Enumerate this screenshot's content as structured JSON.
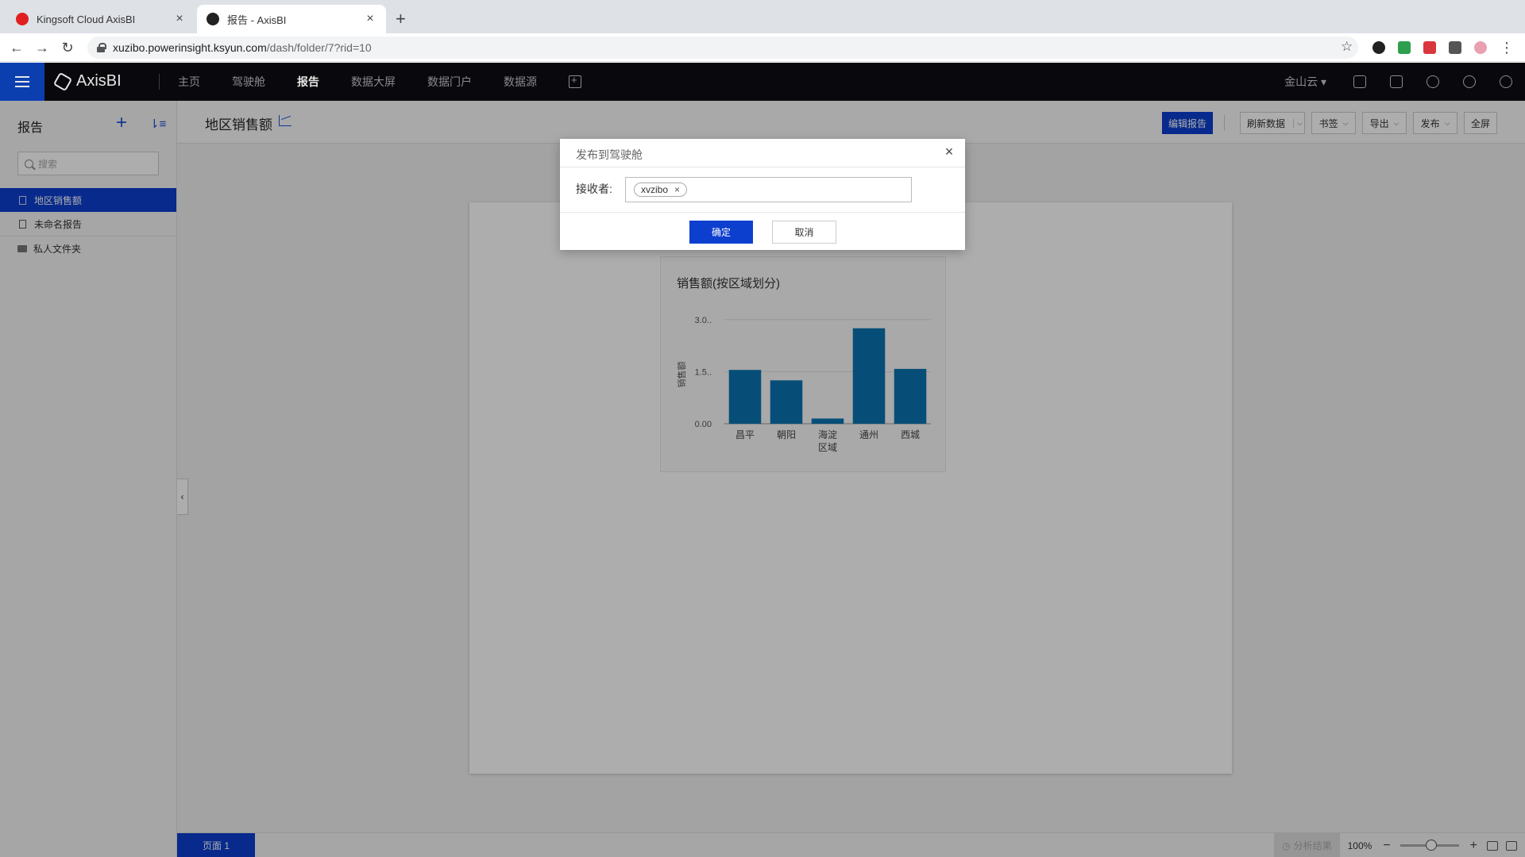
{
  "browser": {
    "tabs": [
      {
        "label": "Kingsoft Cloud AxisBI",
        "favicon_color": "#e02020"
      },
      {
        "label": "报告 - AxisBI",
        "favicon_color": "#222222"
      }
    ],
    "url_host": "xuzibo.powerinsight.ksyun.com",
    "url_path": "/dash/folder/7?rid=10"
  },
  "app": {
    "logo": "AxisBI",
    "nav": [
      "主页",
      "驾驶舱",
      "报告",
      "数据大屏",
      "数据门户",
      "数据源"
    ],
    "active_nav": "报告",
    "org": "金山云"
  },
  "sidebar": {
    "title": "报告",
    "search_placeholder": "搜索",
    "items": [
      {
        "label": "地区销售额",
        "type": "report",
        "selected": true
      },
      {
        "label": "未命名报告",
        "type": "report",
        "selected": false
      },
      {
        "label": "私人文件夹",
        "type": "folder",
        "selected": false
      }
    ]
  },
  "toolbar": {
    "report_title": "地区销售额",
    "edit_label": "编辑报告",
    "refresh_label": "刷新数据",
    "bookmark_label": "书签",
    "export_label": "导出",
    "publish_label": "发布",
    "fullscreen_label": "全屏"
  },
  "chart_data": {
    "type": "bar",
    "title": "销售额(按区域划分)",
    "ylabel": "销售额",
    "xlabel": "",
    "categories": [
      "昌平",
      "朝阳",
      "海淀区域",
      "通州",
      "西城"
    ],
    "category_lines": [
      [
        "昌平"
      ],
      [
        "朝阳"
      ],
      [
        "海淀",
        "区域"
      ],
      [
        "通州"
      ],
      [
        "西城"
      ]
    ],
    "values": [
      1.55,
      1.25,
      0.15,
      2.75,
      1.58
    ],
    "ylim": [
      0,
      3.2
    ],
    "yticks": [
      {
        "value": 0,
        "label": "0.00"
      },
      {
        "value": 1.5,
        "label": "1.5.."
      },
      {
        "value": 3.0,
        "label": "3.0.."
      }
    ],
    "bar_color": "#0a73b0",
    "grid": true
  },
  "footer": {
    "page_tab": "页面 1",
    "analysis_label": "分析结果",
    "zoom": "100%"
  },
  "modal": {
    "title": "发布到驾驶舱",
    "receiver_label": "接收者:",
    "tag": "xvzibo",
    "ok_label": "确定",
    "cancel_label": "取消"
  }
}
